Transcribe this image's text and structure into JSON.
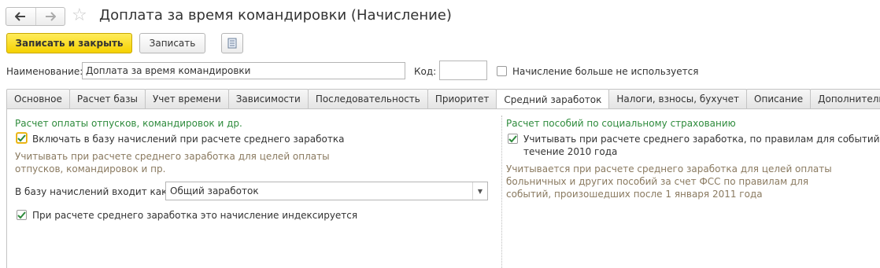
{
  "window": {
    "title": "Доплата за время командировки (Начисление)",
    "nav": {
      "back_icon": "arrow-left-icon",
      "forward_icon": "arrow-right-icon",
      "favorite_icon": "star-icon"
    }
  },
  "toolbar": {
    "save_close_label": "Записать и закрыть",
    "save_label": "Записать",
    "more_icon": "document-menu-icon"
  },
  "header": {
    "name_label": "Наименование:",
    "name_value": "Доплата за время командировки",
    "code_label": "Код:",
    "code_value": "",
    "unused_label": "Начисление больше не используется",
    "unused_checked": false
  },
  "tabs": [
    {
      "label": "Основное",
      "active": false
    },
    {
      "label": "Расчет базы",
      "active": false
    },
    {
      "label": "Учет времени",
      "active": false
    },
    {
      "label": "Зависимости",
      "active": false
    },
    {
      "label": "Последовательность",
      "active": false
    },
    {
      "label": "Приоритет",
      "active": false
    },
    {
      "label": "Средний заработок",
      "active": true
    },
    {
      "label": "Налоги, взносы, бухучет",
      "active": false
    },
    {
      "label": "Описание",
      "active": false
    },
    {
      "label": "Дополнительно",
      "active": false
    }
  ],
  "left_group": {
    "title": "Расчет оплаты отпусков, командировок и др.",
    "include_label": "Включать в базу начислений при расчете среднего заработка",
    "include_checked": true,
    "hint_line1": "Учитывать при расчете среднего заработка для целей оплаты",
    "hint_line2": "отпусков, командировок и пр.",
    "base_label": "В базу начислений входит как:",
    "base_value": "Общий заработок",
    "indexed_label": "При расчете среднего заработка это начисление индексируется",
    "indexed_checked": true
  },
  "right_group": {
    "title": "Расчет пособий по социальному страхованию",
    "fss_label_line1": "Учитывать при расчете среднего заработка, по правилам для событий, прои",
    "fss_label_line2": "течение 2010 года",
    "fss_checked": true,
    "hint_line1": "Учитывается при расчете среднего заработка для целей оплаты",
    "hint_line2": "больничных и других пособий за счет ФСС по правилам для",
    "hint_line3": "событий, произошедших после 1 января 2011 года"
  },
  "colors": {
    "primary_button": "#f5d100",
    "group_title": "#2e8b3c",
    "hint_text": "#8a7a60",
    "checkbox_mark": "#2e8b3c"
  }
}
